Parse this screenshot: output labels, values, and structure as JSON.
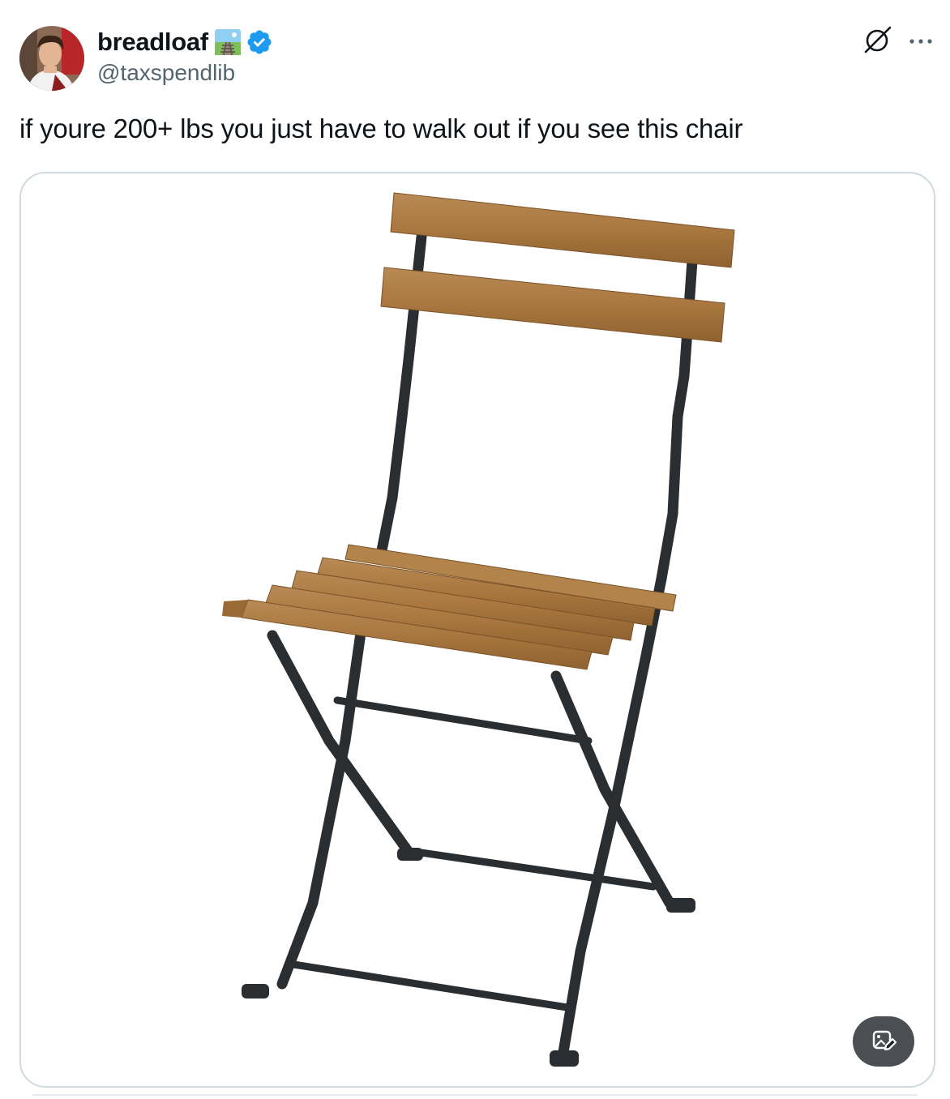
{
  "author": {
    "display_name": "breadloaf",
    "handle": "@taxspendlib",
    "avatar_icon": "avatar",
    "name_emoji": "railway-track-icon",
    "verified_badge": "verified-badge-icon",
    "verified_color": "#1d9bf0"
  },
  "actions": {
    "grok_icon": "grok-icon",
    "more_icon": "more-options-icon"
  },
  "post": {
    "text": "if youre 200+ lbs you just have to walk out if you see this chair"
  },
  "media": {
    "image_subject": "folding-chair-image",
    "edit_button_icon": "edit-image-icon"
  },
  "colors": {
    "text_primary": "#0f1419",
    "text_secondary": "#536471",
    "border": "#cfd9de"
  }
}
